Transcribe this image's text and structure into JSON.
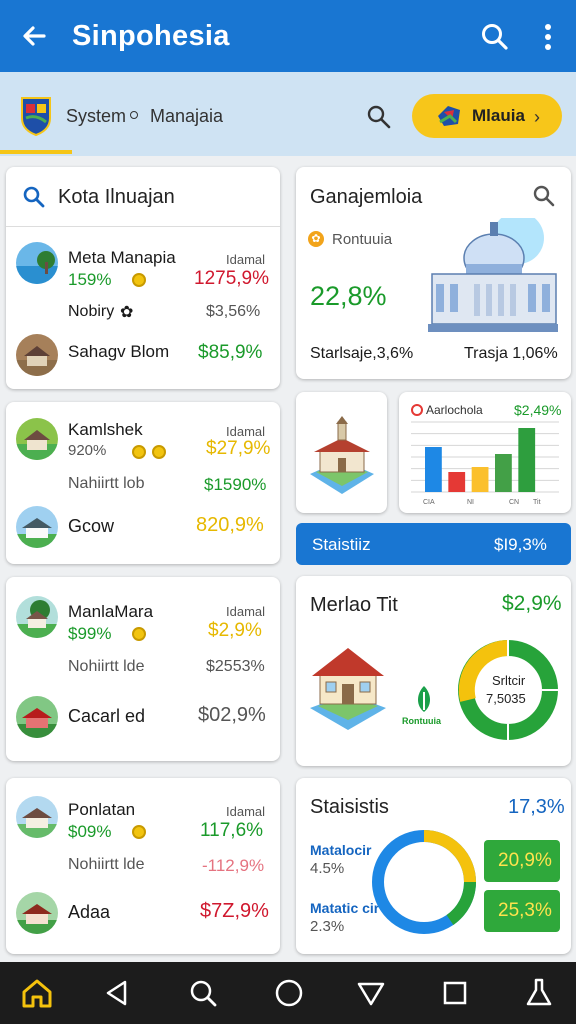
{
  "appbar": {
    "title": "Sinpohesia"
  },
  "subbar": {
    "label1": "System",
    "label2": "Manajaia",
    "pill_label": "Mlauia"
  },
  "card1": {
    "title": "Kota Ilnuajan",
    "row1": {
      "name": "Meta Manapia",
      "tag": "Idamal",
      "pct": "159%",
      "value": "1275,9%"
    },
    "row2": {
      "name": "Nobiry",
      "value": "$3,56%"
    },
    "row3": {
      "name": "Sahagv Blom",
      "value": "$85,9%"
    }
  },
  "card2": {
    "title": "Ganajemloia",
    "label": "Rontuuia",
    "big": "22,8%",
    "left": "Starlsaje,3,6%",
    "right": "Trasja 1,06%"
  },
  "card3": {
    "row1": {
      "name": "Kamlshek",
      "tag": "Idamal",
      "pct": "920%",
      "value": "$27,9%"
    },
    "row2": {
      "name": "Nahiirtt lob",
      "value": "$1590%"
    },
    "row3": {
      "name": "Gcow",
      "value": "820,9%"
    }
  },
  "barcard": {
    "title": "Aarlochola",
    "value": "$2,49%",
    "xlabels": [
      "CIA",
      "NI",
      "CN",
      "Tit"
    ]
  },
  "chart_data": {
    "type": "bar",
    "title": "Aarlochola",
    "categories": [
      "CIA",
      "",
      "NI",
      "",
      "CN",
      "Tit"
    ],
    "values": [
      45,
      20,
      25,
      38,
      64,
      0
    ],
    "colors": [
      "#1e88e5",
      "#e53935",
      "#fbc02d",
      "#43a047",
      "#2e9e3e",
      ""
    ],
    "ylim": [
      0,
      70
    ]
  },
  "statbar": {
    "label": "Staistiiz",
    "value": "$I9,3%"
  },
  "card4": {
    "row1": {
      "name": "ManlaMara",
      "tag": "Idamal",
      "pct": "$99%",
      "value": "$2,9%"
    },
    "row2": {
      "name": "Nohiirtt lde",
      "value": "$2553%"
    },
    "row3": {
      "name": "Cacarl ed",
      "value": "$02,9%"
    }
  },
  "card5": {
    "title": "Merlao Tit",
    "value": "$2,9%",
    "small_label": "Rontuuia",
    "donut_label1": "Srltcir",
    "donut_label2": "7,5035"
  },
  "card6": {
    "row1": {
      "name": "Ponlatan",
      "tag": "Idamal",
      "pct": "$09%",
      "value": "117,6%"
    },
    "row2": {
      "name": "Nohiirtt lde",
      "value": "-112,9%"
    },
    "row3": {
      "name": "Adaa",
      "value": "$7Z,9%"
    }
  },
  "card7": {
    "title": "Staisistis",
    "value": "17,3%",
    "m1_label": "Matalocir",
    "m1_value": "4.5%",
    "m2_label": "Matatic cir",
    "m2_value": "2.3%",
    "badge1": "20,9%",
    "badge2": "25,3%"
  }
}
